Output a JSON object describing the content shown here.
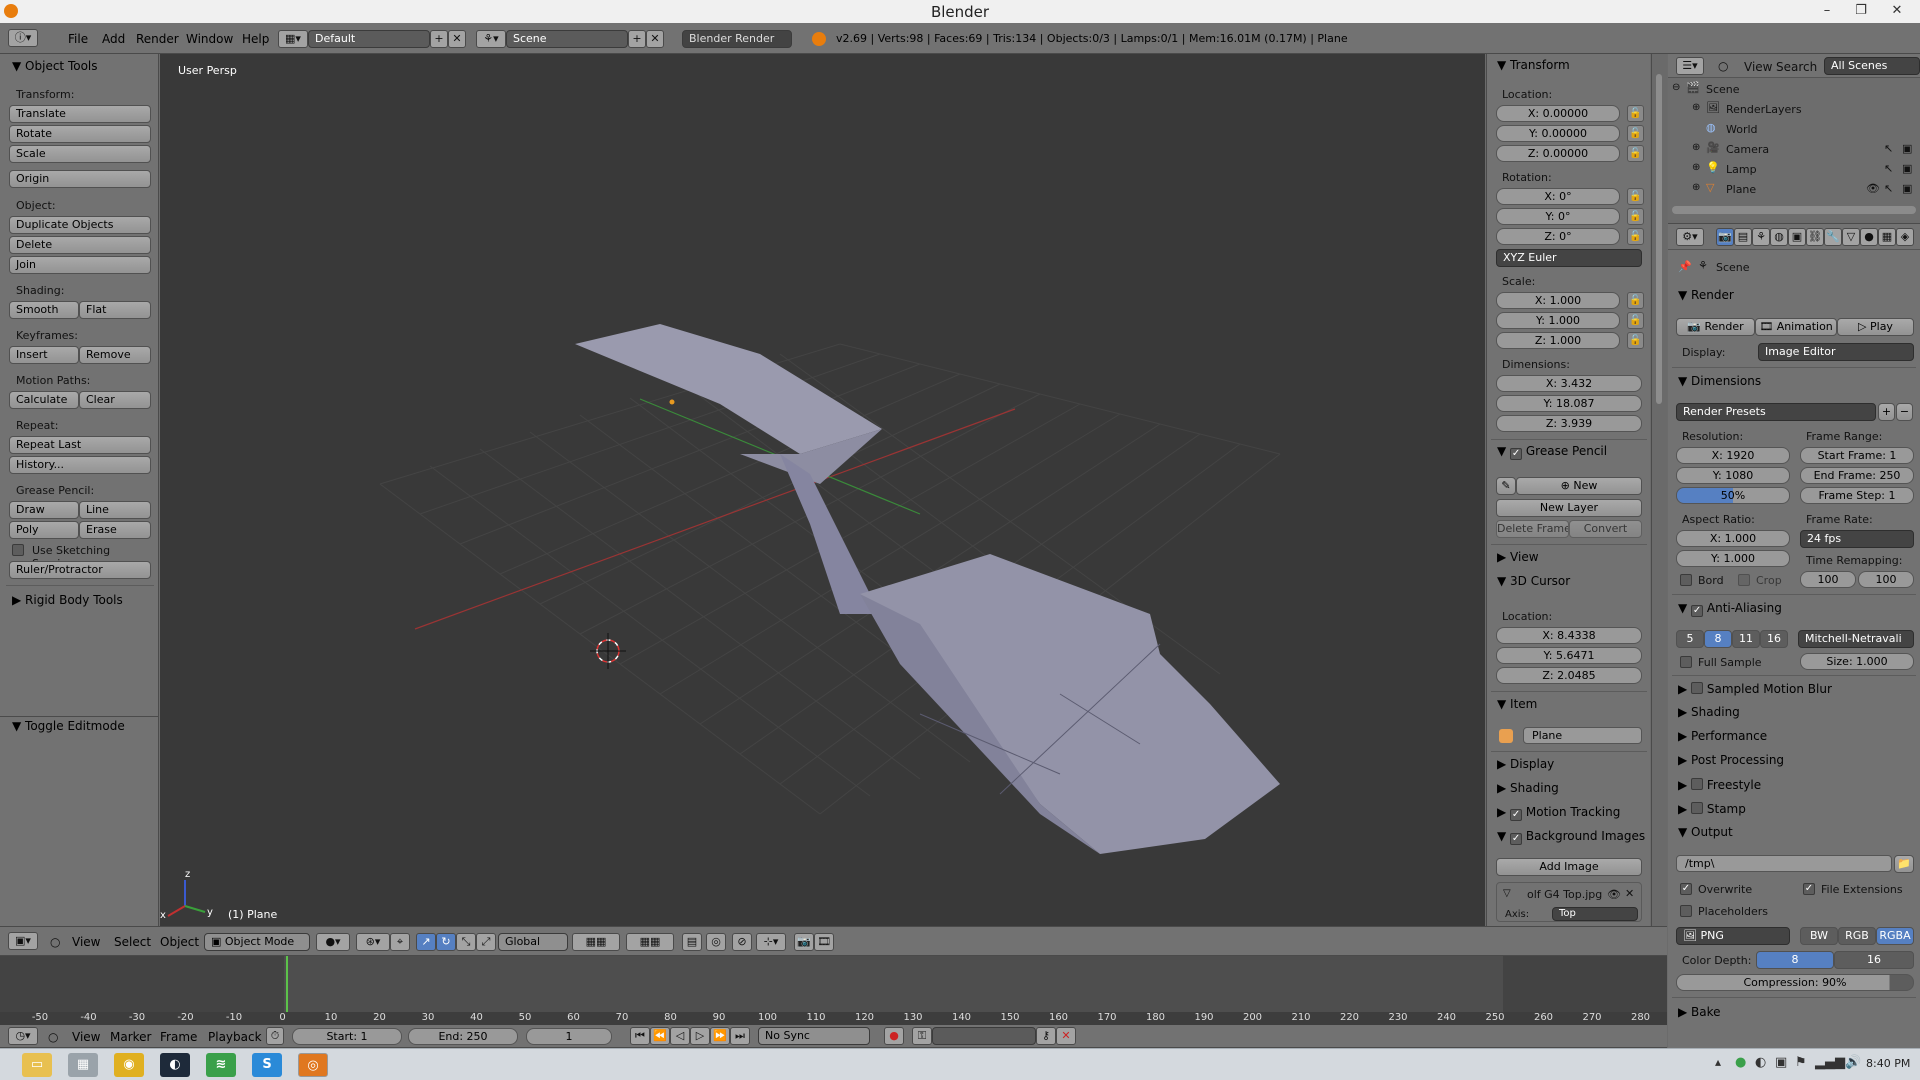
{
  "window": {
    "title": "Blender",
    "min": "–",
    "max": "❐",
    "close": "✕"
  },
  "header": {
    "menus": [
      "File",
      "Add",
      "Render",
      "Window",
      "Help"
    ],
    "layout": "Default",
    "scene": "Scene",
    "engine": "Blender Render",
    "stats": "v2.69 | Verts:98 | Faces:69 | Tris:134 | Objects:0/3 | Lamps:0/1 | Mem:16.01M (0.17M) | Plane"
  },
  "toolshelf": {
    "title": "Object Tools",
    "transform_label": "Transform:",
    "translate": "Translate",
    "rotate": "Rotate",
    "scale": "Scale",
    "origin": "Origin",
    "object_label": "Object:",
    "duplicate": "Duplicate Objects",
    "delete": "Delete",
    "join": "Join",
    "shading_label": "Shading:",
    "smooth": "Smooth",
    "flat": "Flat",
    "keyframes_label": "Keyframes:",
    "insert": "Insert",
    "remove": "Remove",
    "motion_label": "Motion Paths:",
    "calculate": "Calculate",
    "clear": "Clear",
    "repeat_label": "Repeat:",
    "repeat_last": "Repeat Last",
    "history": "History...",
    "grease_label": "Grease Pencil:",
    "draw": "Draw",
    "line": "Line",
    "poly": "Poly",
    "erase": "Erase",
    "sketching": "Use Sketching Sessions",
    "ruler": "Ruler/Protractor",
    "rigid": "Rigid Body Tools",
    "toggle_edit": "Toggle Editmode"
  },
  "viewport": {
    "view_label": "User Persp",
    "object_label": "(1) Plane",
    "axis_x": "x",
    "axis_y": "y",
    "axis_z": "z"
  },
  "view_header": {
    "menus": [
      "View",
      "Select",
      "Object"
    ],
    "mode": "Object Mode",
    "orientation": "Global"
  },
  "npanel": {
    "transform": "Transform",
    "location_label": "Location:",
    "loc_x": "X: 0.00000",
    "loc_y": "Y: 0.00000",
    "loc_z": "Z: 0.00000",
    "rotation_label": "Rotation:",
    "rot_x": "X: 0°",
    "rot_y": "Y: 0°",
    "rot_z": "Z: 0°",
    "rot_mode": "XYZ Euler",
    "scale_label": "Scale:",
    "sc_x": "X: 1.000",
    "sc_y": "Y: 1.000",
    "sc_z": "Z: 1.000",
    "dim_label": "Dimensions:",
    "dim_x": "X: 3.432",
    "dim_y": "Y: 18.087",
    "dim_z": "Z: 3.939",
    "grease": "Grease Pencil",
    "new": "New",
    "new_layer": "New Layer",
    "delete_frame": "Delete Frame",
    "convert": "Convert",
    "view": "View",
    "cursor": "3D Cursor",
    "cur_label": "Location:",
    "cur_x": "X: 8.4338",
    "cur_y": "Y: 5.6471",
    "cur_z": "Z: 2.0485",
    "item": "Item",
    "item_name": "Plane",
    "display": "Display",
    "shading": "Shading",
    "motion": "Motion Tracking",
    "bg_images": "Background Images",
    "add_image": "Add Image",
    "image_name": "olf G4 Top.jpg",
    "axis_label": "Axis:",
    "axis_value": "Top"
  },
  "outliner": {
    "view": "View",
    "search": "Search",
    "filter": "All Scenes",
    "items": [
      "Scene",
      "RenderLayers",
      "World",
      "Camera",
      "Lamp",
      "Plane"
    ]
  },
  "props": {
    "scene": "Scene",
    "render": "Render",
    "render_btn": "Render",
    "animation_btn": "Animation",
    "play_btn": "Play",
    "display_label": "Display:",
    "display_value": "Image Editor",
    "dimensions": "Dimensions",
    "presets": "Render Presets",
    "resolution_label": "Resolution:",
    "res_x": "X: 1920",
    "res_y": "Y: 1080",
    "res_pct": "50%",
    "frame_range_label": "Frame Range:",
    "start": "Start Frame: 1",
    "end": "End Frame: 250",
    "step": "Frame Step: 1",
    "aspect_label": "Aspect Ratio:",
    "asp_x": "X: 1.000",
    "asp_y": "Y: 1.000",
    "frame_rate_label": "Frame Rate:",
    "fps": "24 fps",
    "bord": "Bord",
    "crop": "Crop",
    "remap_label": "Time Remapping:",
    "remap_old": "100",
    "remap_new": "100",
    "aa": "Anti-Aliasing",
    "aa_values": [
      "5",
      "8",
      "11",
      "16"
    ],
    "aa_filter": "Mitchell-Netravali",
    "full_sample": "Full Sample",
    "size": "Size: 1.000",
    "motion_blur": "Sampled Motion Blur",
    "shading": "Shading",
    "performance": "Performance",
    "post": "Post Processing",
    "freestyle": "Freestyle",
    "stamp": "Stamp",
    "output": "Output",
    "path": "/tmp\\",
    "overwrite": "Overwrite",
    "file_ext": "File Extensions",
    "placeholders": "Placeholders",
    "format": "PNG",
    "bw": "BW",
    "rgb": "RGB",
    "rgba": "RGBA",
    "color_depth_label": "Color Depth:",
    "depth_8": "8",
    "depth_16": "16",
    "compression": "Compression: 90%",
    "bake": "Bake"
  },
  "timeline": {
    "ticks": [
      "-50",
      "-40",
      "-30",
      "-20",
      "-10",
      "0",
      "10",
      "20",
      "30",
      "40",
      "50",
      "60",
      "70",
      "80",
      "90",
      "100",
      "110",
      "120",
      "130",
      "140",
      "150",
      "160",
      "170",
      "180",
      "190",
      "200",
      "210",
      "220",
      "230",
      "240",
      "250",
      "260",
      "270",
      "280"
    ],
    "menus": [
      "View",
      "Marker",
      "Frame",
      "Playback"
    ],
    "start": "Start: 1",
    "end": "End: 250",
    "current": "1",
    "sync": "No Sync"
  },
  "taskbar": {
    "clock": "8:40 PM"
  },
  "colors": {
    "viewport_bg": "#393939",
    "panel_bg": "#727272",
    "mesh": "#8f8fa6",
    "x_axis": "#b53030",
    "y_axis": "#3a9a3a",
    "accent": "#5680c2"
  }
}
